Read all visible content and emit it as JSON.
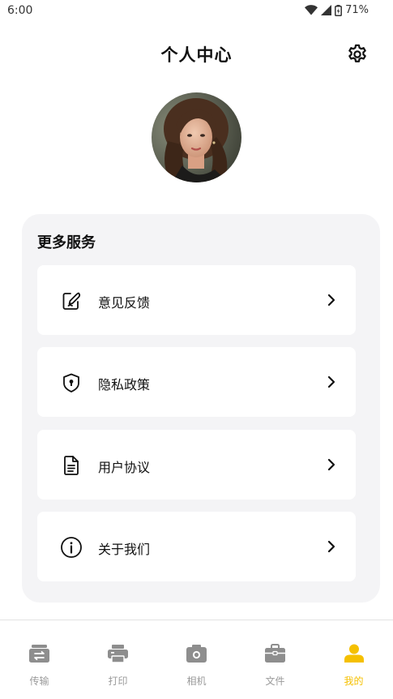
{
  "status_bar": {
    "time": "6:00",
    "battery": "71%"
  },
  "header": {
    "title": "个人中心"
  },
  "icons": {
    "settings": "gear-icon",
    "feedback": "edit-note-icon",
    "privacy": "shield-lock-icon",
    "agreement": "document-icon",
    "about": "info-icon",
    "chevron": "chevron-right-icon"
  },
  "services": {
    "title": "更多服务",
    "items": [
      {
        "label": "意见反馈",
        "icon": "edit-note-icon"
      },
      {
        "label": "隐私政策",
        "icon": "shield-lock-icon"
      },
      {
        "label": "用户协议",
        "icon": "document-icon"
      },
      {
        "label": "关于我们",
        "icon": "info-icon"
      }
    ]
  },
  "tabbar": {
    "tabs": [
      {
        "label": "传输",
        "icon": "transfer-icon",
        "active": false
      },
      {
        "label": "打印",
        "icon": "printer-icon",
        "active": false
      },
      {
        "label": "相机",
        "icon": "camera-icon",
        "active": false
      },
      {
        "label": "文件",
        "icon": "briefcase-icon",
        "active": false
      },
      {
        "label": "我的",
        "icon": "user-icon",
        "active": true
      }
    ]
  },
  "colors": {
    "accent": "#f5c000",
    "inactive": "#9a9a9a",
    "card_bg": "#f4f4f6"
  }
}
